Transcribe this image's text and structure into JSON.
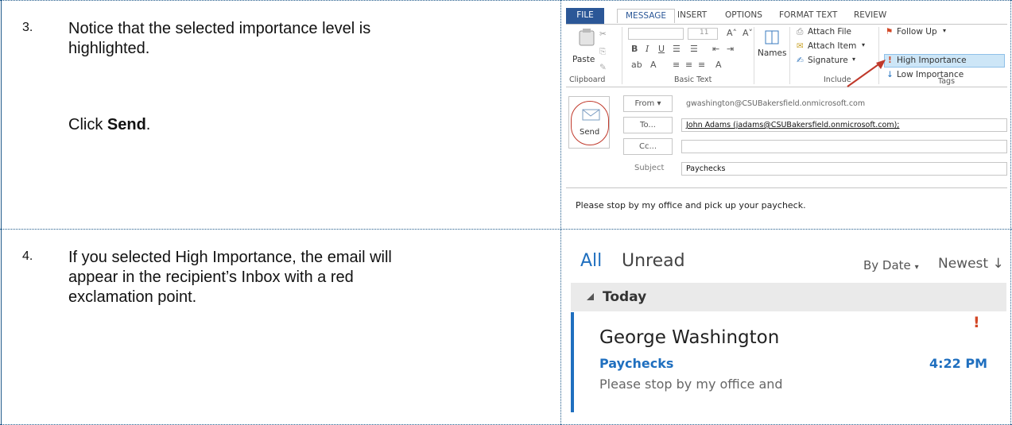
{
  "steps": [
    {
      "number": "3.",
      "text_line1": "Notice that the selected importance level is",
      "text_line2": "highlighted.",
      "click_prefix": "Click ",
      "click_target": "Send",
      "click_suffix": "."
    },
    {
      "number": "4.",
      "text_line1": "If you selected High Importance, the email will",
      "text_line2": "appear in the recipient’s Inbox with a red",
      "text_line3": "exclamation point."
    }
  ],
  "compose": {
    "tabs": [
      "FILE",
      "MESSAGE",
      "INSERT",
      "OPTIONS",
      "FORMAT TEXT",
      "REVIEW"
    ],
    "font_size": "11",
    "paste_label": "Paste",
    "names_label": "Names",
    "attach_file": "Attach File",
    "attach_item": "Attach Item",
    "signature": "Signature",
    "follow_up": "Follow Up",
    "high_importance": "High Importance",
    "low_importance": "Low Importance",
    "groups": [
      "Clipboard",
      "Basic Text",
      "Include",
      "Tags"
    ],
    "send_label": "Send",
    "from_label": "From",
    "to_label": "To...",
    "cc_label": "Cc...",
    "subject_label": "Subject",
    "from_value": "gwashington@CSUBakersfield.onmicrosoft.com",
    "to_value": "John Adams (jadams@CSUBakersfield.onmicrosoft.com);",
    "cc_value": "",
    "subject_value": "Paychecks",
    "body": "Please stop by my office and pick up your paycheck."
  },
  "inbox": {
    "filter_all": "All",
    "filter_unread": "Unread",
    "sort_by": "By Date",
    "order": "Newest",
    "group": "Today",
    "message": {
      "sender": "George Washington",
      "subject": "Paychecks",
      "time": "4:22 PM",
      "preview": "Please stop by my office and",
      "importance": "!"
    }
  },
  "colors": {
    "border": "#1f5a8a",
    "accent": "#1f6fbf",
    "importance": "#d24726",
    "send_ring": "#c0392b"
  }
}
